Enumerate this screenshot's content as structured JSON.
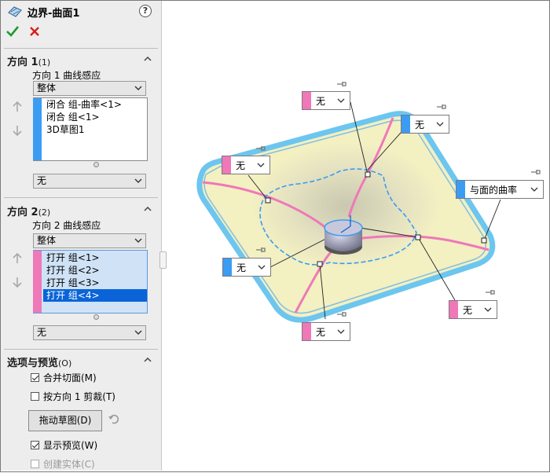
{
  "header": {
    "title": "边界-曲面1",
    "help_label": "?"
  },
  "colors": {
    "pink": "#ef78b8",
    "blue": "#3b9cf4",
    "selection": "#0a64d8",
    "surface": "#f3f0c2",
    "edge": "#6cc6ef"
  },
  "direction1": {
    "heading": "方向 1",
    "count": "(1)",
    "tangency_label": "方向 1 曲线感应",
    "tangency_value": "整体",
    "items": [
      "闭合 组-曲率<1>",
      "闭合 组<1>",
      "3D草图1"
    ],
    "end_value": "无"
  },
  "direction2": {
    "heading": "方向 2",
    "count": "(2)",
    "tangency_label": "方向 2 曲线感应",
    "tangency_value": "整体",
    "items": [
      "打开 组<1>",
      "打开 组<2>",
      "打开 组<3>",
      "打开 组<4>"
    ],
    "selected_index": 3,
    "end_value": "无"
  },
  "options": {
    "heading": "选项与预览",
    "count": "(O)",
    "merge_tangent_label": "合并切面(M)",
    "merge_tangent_checked": true,
    "trim_label": "按方向 1 剪裁(T)",
    "trim_checked": false,
    "drag_sketch_label": "拖动草图(D)",
    "show_preview_label": "显示预览(W)",
    "show_preview_checked": true,
    "create_solid_label": "创建实体(C)",
    "create_solid_checked": false
  },
  "callouts": [
    {
      "text": "无",
      "color": "pink"
    },
    {
      "text": "无",
      "color": "blue"
    },
    {
      "text": "无",
      "color": "pink"
    },
    {
      "text": "与面的曲率",
      "color": "blue"
    },
    {
      "text": "无",
      "color": "blue"
    },
    {
      "text": "无",
      "color": "pink"
    },
    {
      "text": "无",
      "color": "pink"
    }
  ]
}
